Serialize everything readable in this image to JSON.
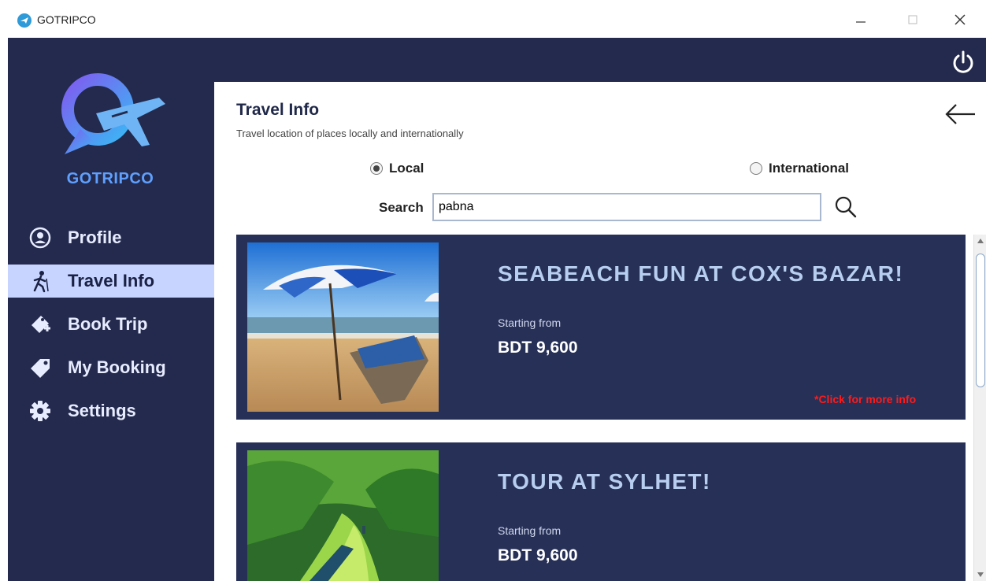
{
  "window": {
    "title": "GOTRIPCO"
  },
  "sidebar": {
    "brand": "GOTRIPCO",
    "items": [
      {
        "label": "Profile",
        "icon": "user-circle-icon",
        "active": false
      },
      {
        "label": "Travel Info",
        "icon": "hiker-icon",
        "active": true
      },
      {
        "label": "Book Trip",
        "icon": "ticket-plus-icon",
        "active": false
      },
      {
        "label": "My Booking",
        "icon": "tag-icon",
        "active": false
      },
      {
        "label": "Settings",
        "icon": "gear-icon",
        "active": false
      }
    ]
  },
  "main": {
    "title": "Travel Info",
    "subtitle": "Travel location of places locally and internationally",
    "radio_local": "Local",
    "radio_international": "International",
    "selected": "Local",
    "search_label": "Search",
    "search_value": "pabna"
  },
  "cards": [
    {
      "title": "SEABEACH FUN AT COX'S BAZAR!",
      "from_label": "Starting from",
      "price": "BDT 9,600",
      "more": "*Click for more info"
    },
    {
      "title": "TOUR AT SYLHET!",
      "from_label": "Starting from",
      "price": "BDT 9,600"
    }
  ],
  "colors": {
    "frame": "#232a4d",
    "card": "#273057",
    "active_nav": "#c7d4ff",
    "card_title": "#b7cef0",
    "link_red": "#ff1b1b"
  }
}
